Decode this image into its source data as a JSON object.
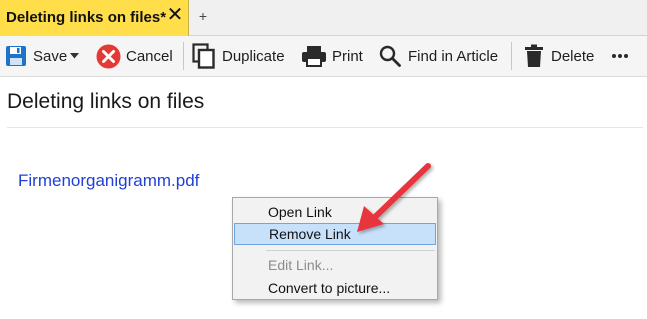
{
  "tab": {
    "title": "Deleting links on files*",
    "close_glyph": "✕",
    "add_glyph": "+"
  },
  "toolbar": {
    "save_label": "Save",
    "cancel_label": "Cancel",
    "duplicate_label": "Duplicate",
    "print_label": "Print",
    "find_label": "Find in Article",
    "delete_label": "Delete",
    "more_glyph": "•••",
    "icons": [
      "save-icon",
      "dropdown-caret-icon",
      "cancel-icon",
      "duplicate-icon",
      "print-icon",
      "search-icon",
      "trash-icon",
      "more-icon"
    ]
  },
  "article": {
    "title": "Deleting links on files",
    "link_text": "Firmenorganigramm.pdf"
  },
  "context_menu": {
    "items": [
      {
        "label": "Open Link",
        "state": "normal"
      },
      {
        "label": "Remove Link",
        "state": "highlighted"
      },
      {
        "label": "Edit Link...",
        "state": "disabled"
      },
      {
        "label": "Convert to picture...",
        "state": "normal"
      }
    ]
  },
  "colors": {
    "tab_active": "#ffde4a",
    "link": "#1f3fd6",
    "menu_highlight": "#c8e1fb",
    "arrow": "#e8353c",
    "cancel_icon": "#e53935",
    "save_icon": "#1e73c8"
  }
}
